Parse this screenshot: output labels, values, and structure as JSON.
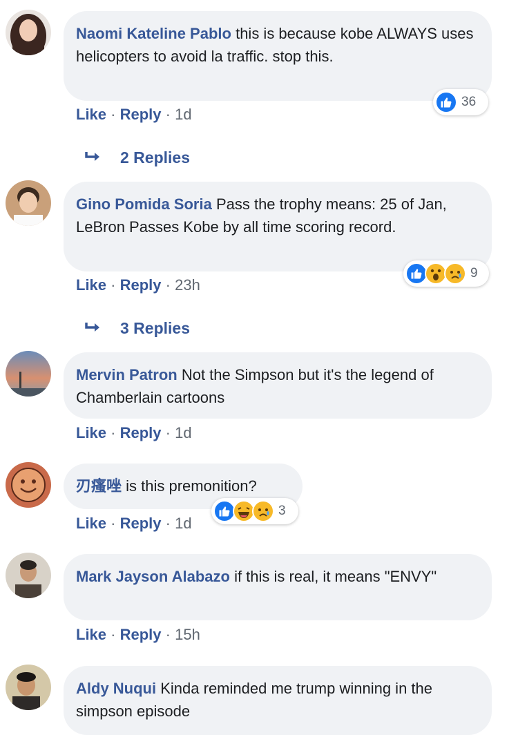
{
  "comments": [
    {
      "author": "Naomi Kateline Pablo",
      "text": "this is because kobe ALWAYS uses helicopters to avoid la traffic. stop this.",
      "like_label": "Like",
      "reply_label": "Reply",
      "time": "1d",
      "reaction_count": "36",
      "reactions": [
        "like"
      ],
      "replies_label": "2 Replies",
      "avatar_color": "#6b4a3a"
    },
    {
      "author": "Gino Pomida Soria",
      "text": "Pass the trophy means: 25 of Jan, LeBron Passes Kobe by all time scoring record.",
      "like_label": "Like",
      "reply_label": "Reply",
      "time": "23h",
      "reaction_count": "9",
      "reactions": [
        "like",
        "wow",
        "sad"
      ],
      "replies_label": "3 Replies",
      "avatar_color": "#c9a07a"
    },
    {
      "author": "Mervin Patron",
      "text": "Not the Simpson but it's the legend of Chamberlain cartoons",
      "like_label": "Like",
      "reply_label": "Reply",
      "time": "1d",
      "avatar_color": "#7f9ab8"
    },
    {
      "author": "刃瘙唑",
      "text": "is this premonition?",
      "like_label": "Like",
      "reply_label": "Reply",
      "time": "1d",
      "reaction_count": "3",
      "reactions": [
        "like",
        "haha",
        "sad"
      ],
      "avatar_color": "#c96a4a"
    },
    {
      "author": "Mark Jayson Alabazo",
      "text": "if this is real, it means \"ENVY\"",
      "like_label": "Like",
      "reply_label": "Reply",
      "time": "15h",
      "avatar_color": "#d8d2c8"
    },
    {
      "author": "Aldy Nuqui",
      "text": "Kinda reminded me trump winning in the simpson episode",
      "avatar_color": "#2e2a28"
    }
  ],
  "colors": {
    "link": "#385898",
    "bubble": "#f0f2f5",
    "like_blue": "#1877f2",
    "emoji_yellow": "#f7b928"
  },
  "icons": {
    "reply_arrow": "reply-arrow-icon",
    "like": "like-reaction-icon",
    "wow": "wow-reaction-icon",
    "sad": "sad-reaction-icon",
    "haha": "haha-reaction-icon"
  }
}
